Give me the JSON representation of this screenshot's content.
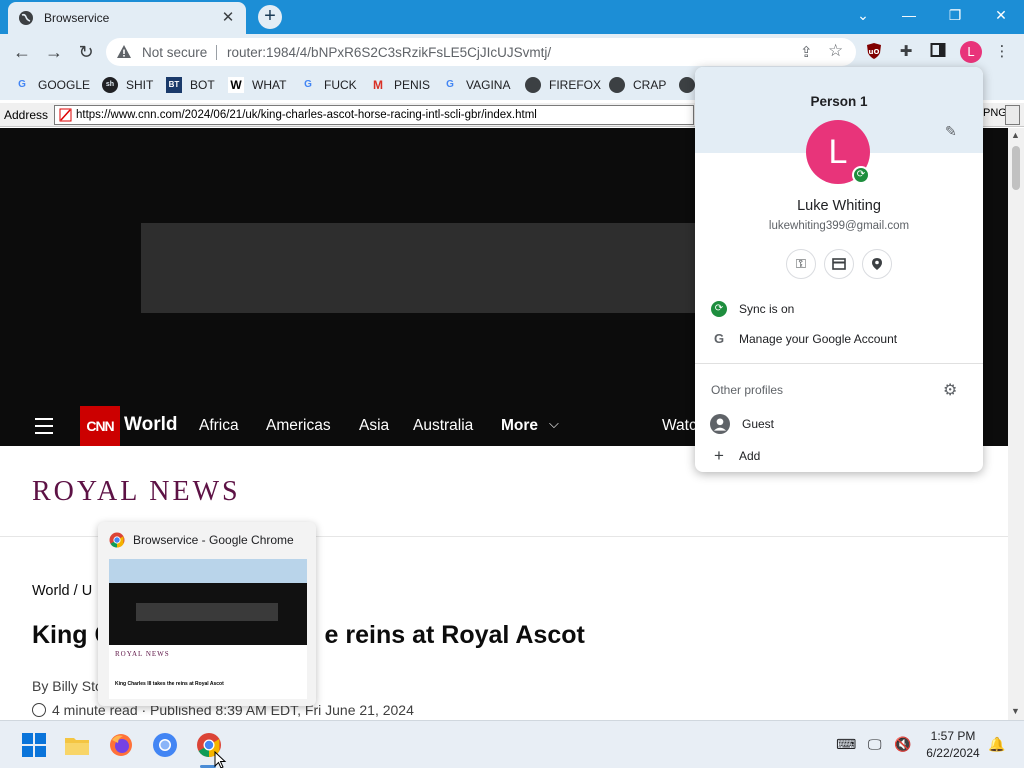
{
  "tab": {
    "title": "Browservice",
    "close": "✕",
    "new_tab": "+"
  },
  "window_controls": {
    "dropdown": "⌄",
    "minimize": "—",
    "restore": "❐",
    "close": "✕"
  },
  "omnibox": {
    "security": "Not secure",
    "url": "router:1984/4/bNPxR6S2C3sRzikFsLE5CjJIcUJSvmtj/"
  },
  "bookmarks": [
    {
      "label": "GOOGLE",
      "icon": "google-icon"
    },
    {
      "label": "SHIT",
      "icon": "sh-icon"
    },
    {
      "label": "BOT",
      "icon": "bt-icon"
    },
    {
      "label": "WHAT",
      "icon": "w-icon"
    },
    {
      "label": "FUCK",
      "icon": "google-icon"
    },
    {
      "label": "PENIS",
      "icon": "gmail-icon"
    },
    {
      "label": "VAGINA",
      "icon": "google-icon"
    },
    {
      "label": "FIREFOX",
      "icon": "globe-icon"
    },
    {
      "label": "CRAP",
      "icon": "globe-icon"
    }
  ],
  "address_bar": {
    "label": "Address",
    "url": "https://www.cnn.com/2024/06/21/uk/king-charles-ascot-horse-racing-intl-scli-gbr/index.html",
    "format": "PNG"
  },
  "cnn_nav": {
    "logo": "CNN",
    "section": "World",
    "links": [
      "Africa",
      "Americas",
      "Asia",
      "Australia"
    ],
    "more": "More",
    "watch": "Watc"
  },
  "article": {
    "section_banner": "ROYAL NEWS",
    "breadcrumb": "World  /  U",
    "headline_left": "King C",
    "headline_right": "e reins at Royal Ascot",
    "byline": "By Billy Stoc",
    "meta": "4 minute read  ·  Published 8:39 AM EDT, Fri June 21, 2024"
  },
  "preview": {
    "title": "Browservice - Google Chrome",
    "thumb_banner": "ROYAL NEWS",
    "thumb_headline": "King Charles III takes the reins at Royal Ascot"
  },
  "profile": {
    "heading": "Person 1",
    "avatar_letter": "L",
    "name": "Luke Whiting",
    "email": "lukewhiting399@gmail.com",
    "sync": "Sync is on",
    "manage": "Manage your Google Account",
    "other_profiles": "Other profiles",
    "guest": "Guest",
    "add": "Add"
  },
  "taskbar": {
    "time": "1:57 PM",
    "date": "6/22/2024"
  },
  "colors": {
    "chrome_blue": "#1c8ed6",
    "toolbar_bg": "#e3edf5",
    "avatar_pink": "#e8347a",
    "cnn_red": "#cc0000",
    "royal_purple": "#5d1245",
    "sync_green": "#1e8e3e"
  }
}
